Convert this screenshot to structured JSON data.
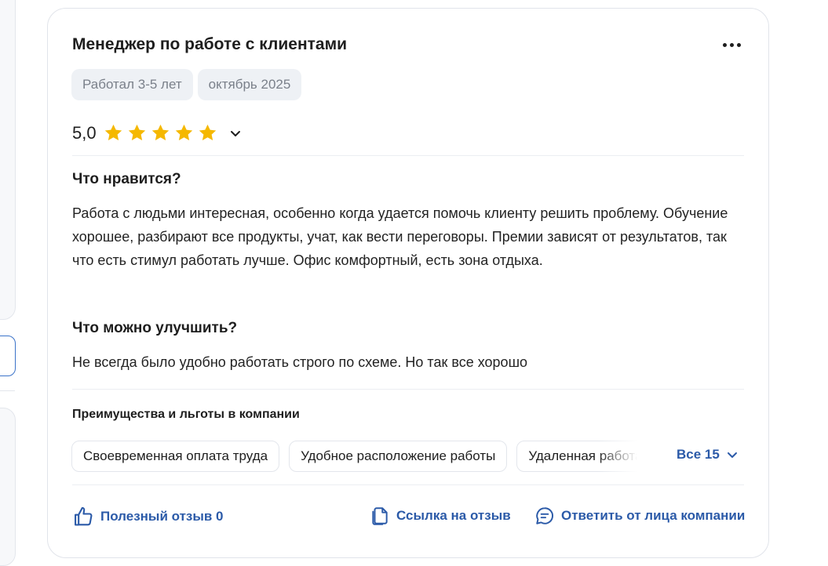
{
  "review": {
    "title": "Менеджер по работе с клиентами",
    "tags": [
      "Работал 3-5 лет",
      "октябрь 2025"
    ],
    "rating": "5,0",
    "stars": 5,
    "likes": {
      "title": "Что нравится?",
      "text": "Работа с людьми интересная, особенно когда удается помочь клиенту решить проблему. Обучение хорошее, разбирают все продукты, учат, как вести переговоры. Премии зависят от результатов, так что есть стимул работать лучше. Офис комфортный, есть зона отдыха."
    },
    "improve": {
      "title": "Что можно улучшить?",
      "text": "Не всегда было удобно работать строго по схеме. Но так все хорошо"
    },
    "benefits": {
      "title": "Преимущества и льготы в компании",
      "items": [
        "Своевременная оплата труда",
        "Удобное расположение работы",
        "Удаленная работа"
      ],
      "all_label": "Все 15"
    },
    "actions": {
      "helpful": "Полезный отзыв 0",
      "link": "Ссылка на отзыв",
      "reply": "Ответить от лица компании"
    }
  },
  "colors": {
    "accent": "#2b5aa8",
    "star": "#f5b800",
    "tag_bg": "#eef1f5",
    "tag_text": "#7a808a",
    "border": "#e1e4ea"
  },
  "icons": [
    "more-dots-icon",
    "star-icon",
    "chevron-down-icon",
    "thumb-up-icon",
    "copy-link-icon",
    "chat-bubble-icon"
  ]
}
